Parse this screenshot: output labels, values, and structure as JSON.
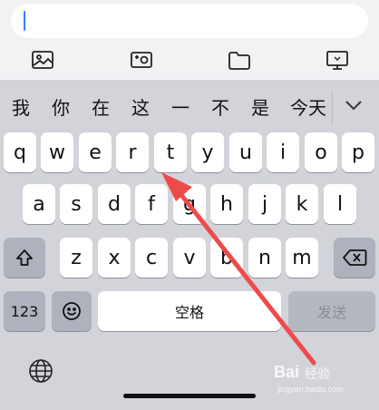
{
  "candidates": [
    "我",
    "你",
    "在",
    "这",
    "一",
    "不",
    "是",
    "今天"
  ],
  "rows": {
    "row1": [
      "q",
      "w",
      "e",
      "r",
      "t",
      "y",
      "u",
      "i",
      "o",
      "p"
    ],
    "row2": [
      "a",
      "s",
      "d",
      "f",
      "g",
      "h",
      "j",
      "k",
      "l"
    ],
    "row3": [
      "z",
      "x",
      "c",
      "v",
      "b",
      "n",
      "m"
    ]
  },
  "keys": {
    "numbers": "123",
    "space": "空格",
    "send": "发送"
  },
  "icons": {
    "toolbar": [
      "image-icon",
      "photo-icon",
      "folder-icon",
      "desktop-icon"
    ],
    "shift": "shift-icon",
    "backspace": "backspace-icon",
    "emoji": "emoji-icon",
    "globe": "globe-icon",
    "expand": "chevron-down-icon"
  },
  "watermark": {
    "brand": "Bai",
    "sub": "经验",
    "url": "jingyan.baidu.com"
  },
  "colors": {
    "arrow": "#ef4a4a",
    "cursor": "#3a7bff",
    "keyboard_bg": "#d2d4da"
  }
}
